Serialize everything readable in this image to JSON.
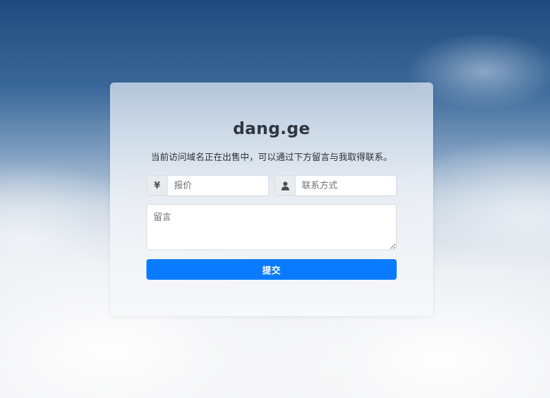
{
  "domain_title": "dang.ge",
  "subtitle": "当前访问域名正在出售中，可以通过下方留言与我取得联系。",
  "form": {
    "price": {
      "addon_symbol": "¥",
      "placeholder": "报价"
    },
    "contact": {
      "addon_icon": "user-icon",
      "placeholder": "联系方式"
    },
    "message": {
      "placeholder": "留言"
    },
    "submit_label": "提交"
  },
  "colors": {
    "accent": "#0a7bff",
    "title": "#2f3640",
    "addon_bg": "#e9ecef"
  }
}
